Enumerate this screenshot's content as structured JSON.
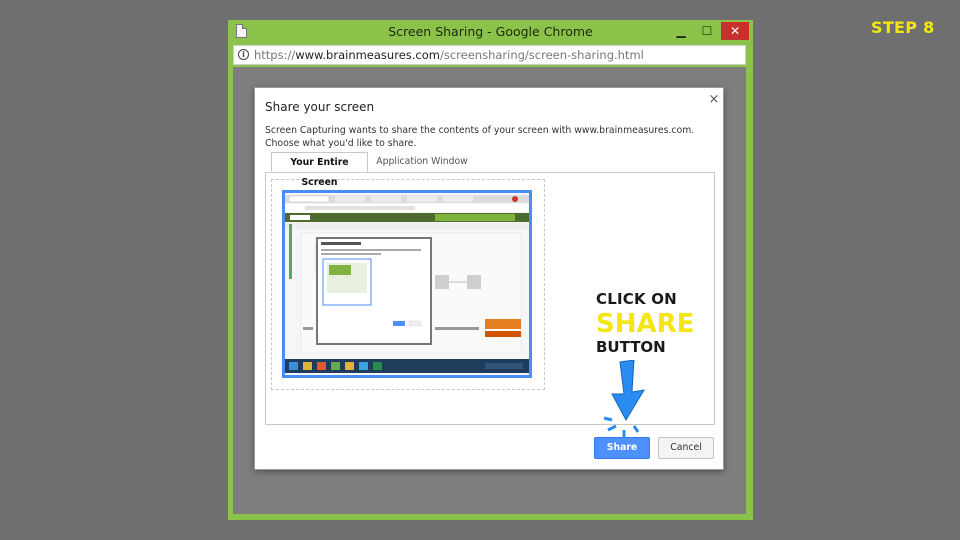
{
  "step": {
    "label": "STEP 8"
  },
  "window": {
    "title": "Screen Sharing - Google Chrome",
    "controls": {
      "minimize": "▁",
      "maximize": "☐",
      "close": "✕"
    },
    "frame_color": "#8bc34a"
  },
  "address": {
    "url_prefix": "https://",
    "url_domain": "www.brainmeasures.com",
    "url_path": "/screensharing/screen-sharing.html"
  },
  "dialog": {
    "title": "Share your screen",
    "close": "×",
    "description": "Screen Capturing wants to share the contents of your screen with www.brainmeasures.com. Choose what you'd like to share.",
    "tabs": [
      {
        "label": "Your Entire Screen",
        "active": true
      },
      {
        "label": "Application Window",
        "active": false
      }
    ],
    "share_label": "Share",
    "cancel_label": "Cancel",
    "accent": "#4d90fe"
  },
  "callout": {
    "line1": "CLICK ON",
    "line2": "SHARE",
    "line3": "BUTTON",
    "highlight_color": "#f4e612",
    "arrow_color": "#2a8cf0"
  }
}
